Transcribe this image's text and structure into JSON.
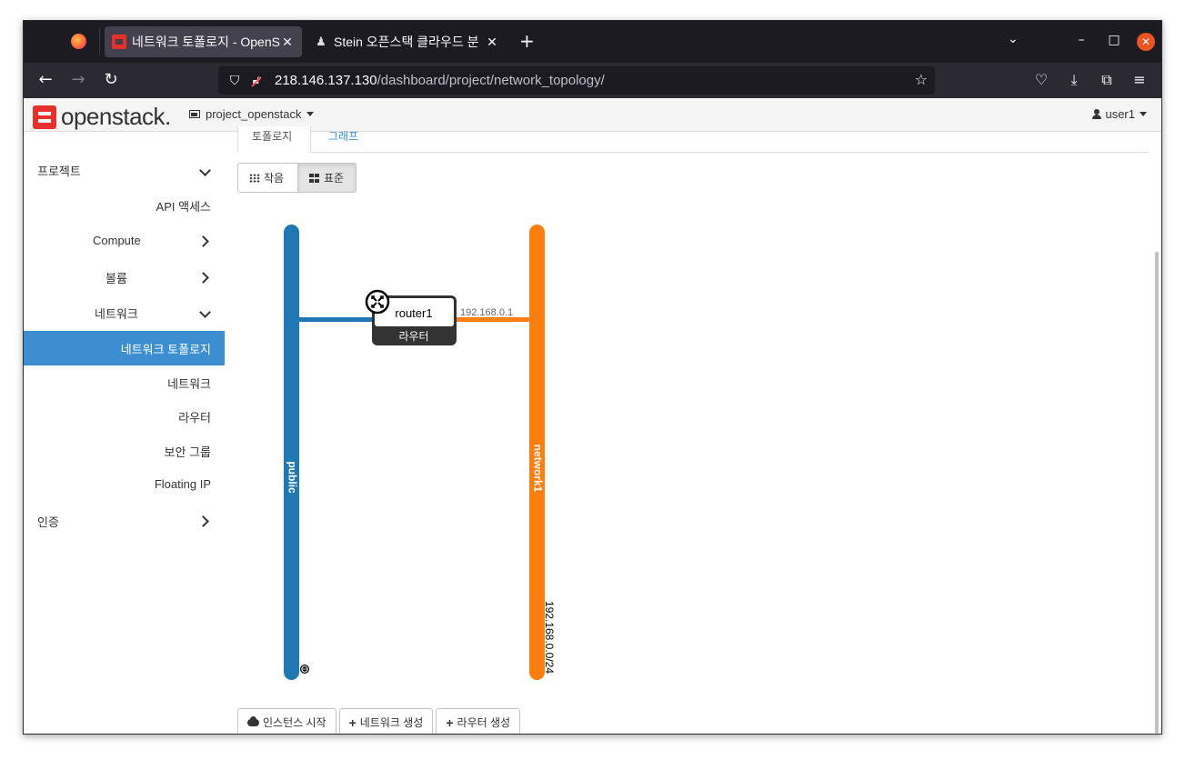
{
  "browser": {
    "tabs": [
      {
        "title": "네트워크 토폴로지 - OpenStack",
        "active": true
      },
      {
        "title": "Stein 오픈스택 클라우드 분",
        "active": false
      }
    ],
    "url_host": "218.146.137.130",
    "url_path": "/dashboard/project/network_topology/"
  },
  "header": {
    "logo_text": "openstack",
    "logo_suffix": ".",
    "project": "project_openstack",
    "user": "user1"
  },
  "sidebar": {
    "items": [
      {
        "label": "프로젝트",
        "chevron": "down"
      },
      {
        "label": "API 액세스"
      },
      {
        "label": "Compute",
        "chevron": "right"
      },
      {
        "label": "볼륨",
        "chevron": "right"
      },
      {
        "label": "네트워크",
        "chevron": "down"
      },
      {
        "label": "네트워크 토폴로지",
        "active": true
      },
      {
        "label": "네트워크"
      },
      {
        "label": "라우터"
      },
      {
        "label": "보안 그룹"
      },
      {
        "label": "Floating IP"
      },
      {
        "label": "인증",
        "chevron": "right"
      }
    ]
  },
  "main": {
    "tabs": [
      "토폴로지",
      "그래프"
    ],
    "view_buttons": [
      {
        "label": "작음",
        "pressed": false
      },
      {
        "label": "표준",
        "pressed": true
      }
    ],
    "topology": {
      "networks": [
        {
          "name": "public",
          "color": "#1f77b4"
        },
        {
          "name": "network1",
          "color": "#ff7f0e",
          "cidr": "192.168.0.0/24"
        }
      ],
      "router": {
        "name": "router1",
        "type_label": "라우터",
        "port_ip": "192.168.0.1"
      }
    },
    "actions": [
      {
        "label": "인스턴스 시작",
        "icon": "cloud-upload-icon"
      },
      {
        "label": "네트워크 생성",
        "icon": "plus-icon"
      },
      {
        "label": "라우터 생성",
        "icon": "plus-icon"
      }
    ]
  }
}
